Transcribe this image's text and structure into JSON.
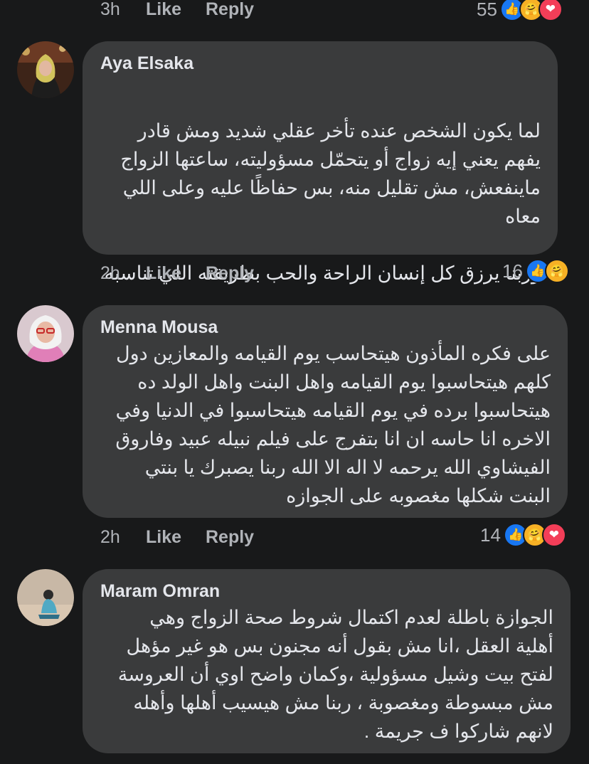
{
  "top_row": {
    "time": "3h",
    "like": "Like",
    "reply": "Reply",
    "count": "55",
    "reactions": [
      "like-icon",
      "care-icon",
      "love-icon"
    ]
  },
  "comments": [
    {
      "author": "Aya Elsaka",
      "lines": [
        "لما يكون الشخص عنده تأخر عقلي شديد ومش قادر",
        "يفهم يعني إيه زواج أو يتحمّل مسؤوليته، ساعتها الزواج",
        "ماينفعش، مش تقليل منه، بس حفاظًا عليه وعلى اللي",
        "معاه",
        "",
        "وربنا يرزق كل إنسان الراحة والحب بطريقته اللي تناسبه"
      ],
      "time": "2h",
      "like": "Like",
      "reply": "Reply",
      "count": "16",
      "reactions": [
        "like-icon",
        "care-icon"
      ]
    },
    {
      "author": "Menna Mousa",
      "lines": [
        "على فكره المأذون هيتحاسب يوم القيامه والمعازين دول",
        "كلهم هيتحاسبوا يوم القيامه واهل البنت واهل الولد ده",
        "هيتحاسبوا برده في يوم القيامه هيتحاسبوا في الدنيا وفي",
        "الاخره انا حاسه ان انا بتفرج على فيلم نبيله عبيد وفاروق",
        "الفيشاوي الله يرحمه لا اله الا الله ربنا يصبرك يا بنتي",
        "البنت شكلها مغصوبه على الجوازه"
      ],
      "time": "2h",
      "like": "Like",
      "reply": "Reply",
      "count": "14",
      "reactions": [
        "like-icon",
        "care-icon",
        "love-icon"
      ]
    },
    {
      "author": "Maram Omran",
      "lines": [
        "الجوازة باطلة لعدم اكتمال شروط صحة الزواج وهي",
        "أهلية  العقل ،انا مش بقول أنه مجنون بس هو غير مؤهل",
        "لفتح بيت وشيل مسؤولية ،وكمان واضح اوي أن العروسة",
        "مش مبسوطة ومغصوبة ، ربنا مش هيسيب أهلها وأهله",
        "لانهم شاركوا ف جريمة ."
      ]
    }
  ],
  "colors": {
    "background": "#18191a",
    "bubble": "#3a3b3c",
    "text": "#e4e6eb",
    "muted": "#b0b3b8",
    "like": "#1877f2",
    "love": "#f33e58",
    "care": "#f7b125"
  }
}
